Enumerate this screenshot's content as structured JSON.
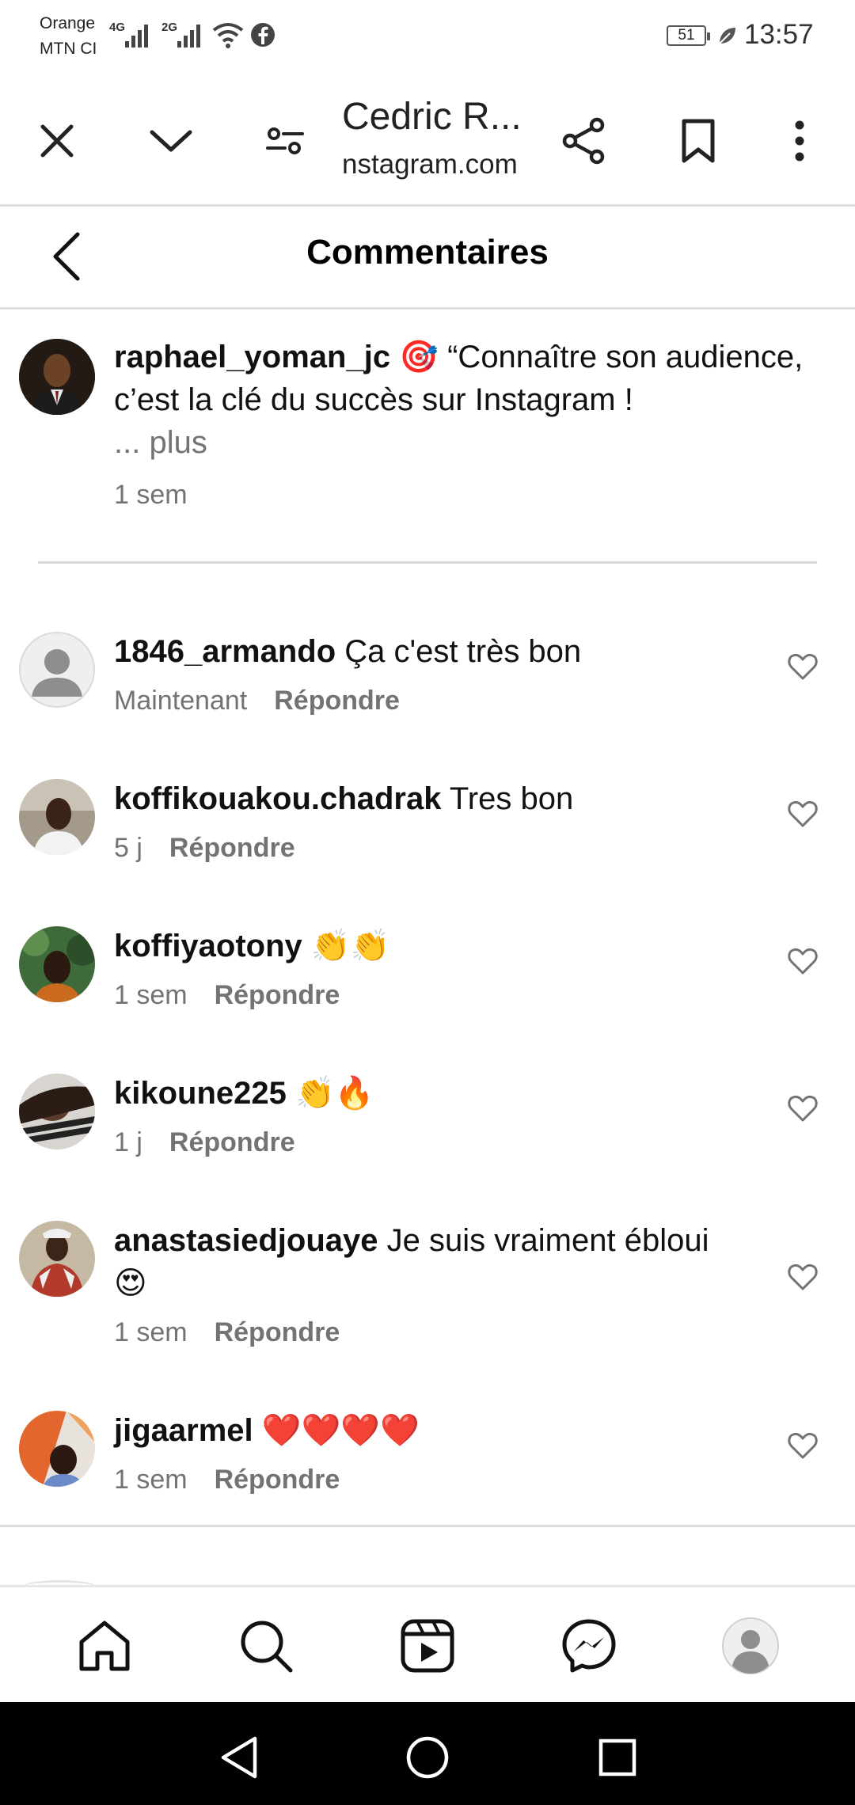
{
  "status_bar": {
    "carrier1": "Orange",
    "carrier2": "MTN CI",
    "net1": "4G",
    "net2": "2G",
    "battery": "51",
    "time": "13:57"
  },
  "browser": {
    "title": "Cedric R...",
    "url": "nstagram.com",
    "icons": [
      "close-icon",
      "chevron-down-icon",
      "settings-sliders-icon",
      "share-icon",
      "bookmark-icon",
      "more-vertical-icon"
    ]
  },
  "header": {
    "title": "Commentaires",
    "back_icon": "back-arrow-icon"
  },
  "caption": {
    "username": "raphael_yoman_jc",
    "text": "🎯 “Connaître son audience, c’est la clé du succès sur Instagram !",
    "more": "... plus",
    "time": "1 sem"
  },
  "comments": [
    {
      "username": "1846_armando",
      "text": "Ça c'est très bon",
      "time": "Maintenant",
      "reply": "Répondre"
    },
    {
      "username": "koffikouakou.chadrak",
      "text": "Tres bon",
      "time": "5 j",
      "reply": "Répondre"
    },
    {
      "username": "koffiyaotony",
      "text": "👏👏",
      "time": "1 sem",
      "reply": "Répondre"
    },
    {
      "username": "kikoune225",
      "text": "👏🔥",
      "time": "1 j",
      "reply": "Répondre"
    },
    {
      "username": "anastasiedjouaye",
      "text": "Je suis vraiment ébloui 😍",
      "time": "1 sem",
      "reply": "Répondre"
    },
    {
      "username": "jigaarmel",
      "text": "❤️❤️❤️❤️",
      "time": "1 sem",
      "reply": "Répondre"
    }
  ],
  "bottom_nav": [
    "home-icon",
    "search-icon",
    "reels-icon",
    "messenger-icon",
    "profile-icon"
  ],
  "colors": {
    "muted": "#737373",
    "divider": "#e0e0e0"
  }
}
